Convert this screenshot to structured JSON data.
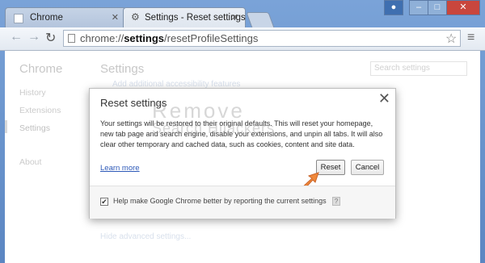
{
  "window": {
    "tabs": [
      {
        "label": "Chrome",
        "icon": "page-icon",
        "active": false
      },
      {
        "label": "Settings - Reset settings",
        "icon": "gear-icon",
        "active": true
      }
    ],
    "user_icon": "user-icon",
    "minimize_icon": "minimize-icon",
    "maximize_icon": "maximize-icon",
    "close_icon": "close-icon"
  },
  "toolbar": {
    "url_scheme": "chrome://",
    "url_host": "settings",
    "url_path": "/resetProfileSettings",
    "back_icon": "back-arrow-icon",
    "forward_icon": "forward-arrow-icon",
    "reload_icon": "reload-icon",
    "star_icon": "star-icon",
    "menu_icon": "hamburger-menu-icon"
  },
  "page": {
    "sidebar_title": "Chrome",
    "sidebar_items": [
      {
        "label": "History"
      },
      {
        "label": "Extensions"
      },
      {
        "label": "Settings"
      },
      {
        "label": "About"
      }
    ],
    "main_title": "Settings",
    "search_placeholder": "Search settings",
    "accessibility_link": "Add additional accessibility features",
    "hide_advanced": "Hide advanced settings..."
  },
  "dialog": {
    "title": "Reset settings",
    "body": "Your settings will be restored to their original defaults. This will reset your homepage, new tab page and search engine, disable your extensions, and unpin all tabs. It will also clear other temporary and cached data, such as cookies, content and site data.",
    "learn_more": "Learn more",
    "reset_label": "Reset",
    "cancel_label": "Cancel",
    "report_label": "Help make Google Chrome better by reporting the current settings",
    "report_checked": true
  },
  "watermark": {
    "line1": "Remove",
    "line2": "Search Hijackers"
  },
  "colors": {
    "accent_link": "#2d59b8",
    "arrow": "#f0883a",
    "frame": "#6b8fc0"
  }
}
